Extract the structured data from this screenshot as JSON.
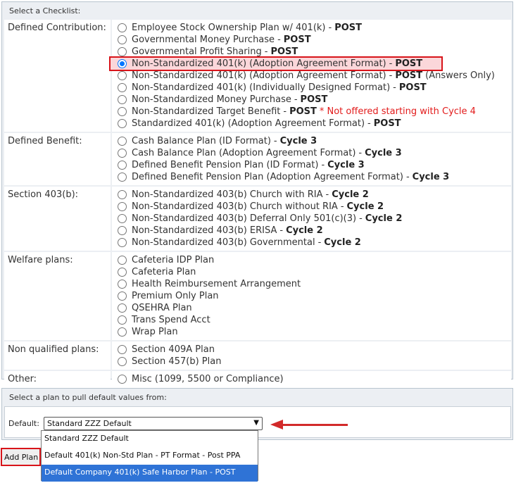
{
  "checklist": {
    "header": "Select a Checklist:",
    "sections": [
      {
        "label": "Defined Contribution:",
        "options": [
          {
            "name": "Employee Stock Ownership Plan w/ 401(k)",
            "tag": "POST",
            "suffix": "",
            "note": "",
            "checked": false
          },
          {
            "name": "Governmental Money Purchase",
            "tag": "POST",
            "suffix": "",
            "note": "",
            "checked": false
          },
          {
            "name": "Governmental Profit Sharing",
            "tag": "POST",
            "suffix": "",
            "note": "",
            "checked": false
          },
          {
            "name": "Non-Standardized 401(k) (Adoption Agreement Format)",
            "tag": "POST",
            "suffix": "",
            "note": "",
            "checked": true
          },
          {
            "name": "Non-Standardized 401(k) (Adoption Agreement Format)",
            "tag": "POST",
            "suffix": "(Answers Only)",
            "note": "",
            "checked": false
          },
          {
            "name": "Non-Standardized 401(k) (Individually Designed Format)",
            "tag": "POST",
            "suffix": "",
            "note": "",
            "checked": false
          },
          {
            "name": "Non-Standardized Money Purchase",
            "tag": "POST",
            "suffix": "",
            "note": "",
            "checked": false
          },
          {
            "name": "Non-Standardized Target Benefit",
            "tag": "POST",
            "suffix": "",
            "note": "* Not offered starting with Cycle 4",
            "checked": false
          },
          {
            "name": "Standardized 401(k) (Adoption Agreement Format)",
            "tag": "POST",
            "suffix": "",
            "note": "",
            "checked": false
          }
        ]
      },
      {
        "label": "Defined Benefit:",
        "options": [
          {
            "name": "Cash Balance Plan (ID Format)",
            "tag": "Cycle 3",
            "suffix": "",
            "note": "",
            "checked": false
          },
          {
            "name": "Cash Balance Plan (Adoption Agreement Format)",
            "tag": "Cycle 3",
            "suffix": "",
            "note": "",
            "checked": false
          },
          {
            "name": "Defined Benefit Pension Plan (ID Format)",
            "tag": "Cycle 3",
            "suffix": "",
            "note": "",
            "checked": false
          },
          {
            "name": "Defined Benefit Pension Plan (Adoption Agreement Format)",
            "tag": "Cycle 3",
            "suffix": "",
            "note": "",
            "checked": false
          }
        ]
      },
      {
        "label": "Section 403(b):",
        "options": [
          {
            "name": "Non-Standardized 403(b) Church with RIA",
            "tag": "Cycle 2",
            "suffix": "",
            "note": "",
            "checked": false
          },
          {
            "name": "Non-Standardized 403(b) Church without RIA",
            "tag": "Cycle 2",
            "suffix": "",
            "note": "",
            "checked": false
          },
          {
            "name": "Non-Standardized 403(b) Deferral Only 501(c)(3)",
            "tag": "Cycle 2",
            "suffix": "",
            "note": "",
            "checked": false
          },
          {
            "name": "Non-Standardized 403(b) ERISA",
            "tag": "Cycle 2",
            "suffix": "",
            "note": "",
            "checked": false
          },
          {
            "name": "Non-Standardized 403(b) Governmental",
            "tag": "Cycle 2",
            "suffix": "",
            "note": "",
            "checked": false
          }
        ]
      },
      {
        "label": "Welfare plans:",
        "options": [
          {
            "name": "Cafeteria IDP Plan",
            "tag": "",
            "suffix": "",
            "note": "",
            "checked": false
          },
          {
            "name": "Cafeteria Plan",
            "tag": "",
            "suffix": "",
            "note": "",
            "checked": false
          },
          {
            "name": "Health Reimbursement Arrangement",
            "tag": "",
            "suffix": "",
            "note": "",
            "checked": false
          },
          {
            "name": "Premium Only Plan",
            "tag": "",
            "suffix": "",
            "note": "",
            "checked": false
          },
          {
            "name": "QSEHRA Plan",
            "tag": "",
            "suffix": "",
            "note": "",
            "checked": false
          },
          {
            "name": "Trans Spend Acct",
            "tag": "",
            "suffix": "",
            "note": "",
            "checked": false
          },
          {
            "name": "Wrap Plan",
            "tag": "",
            "suffix": "",
            "note": "",
            "checked": false
          }
        ]
      },
      {
        "label": "Non qualified plans:",
        "options": [
          {
            "name": "Section 409A Plan",
            "tag": "",
            "suffix": "",
            "note": "",
            "checked": false
          },
          {
            "name": "Section 457(b) Plan",
            "tag": "",
            "suffix": "",
            "note": "",
            "checked": false
          }
        ]
      },
      {
        "label": "Other:",
        "options": [
          {
            "name": "Misc (1099, 5500 or Compliance)",
            "tag": "",
            "suffix": "",
            "note": "",
            "checked": false
          }
        ]
      }
    ]
  },
  "default_panel": {
    "header": "Select a plan to pull default values from:",
    "label": "Default:",
    "selected": "Standard ZZZ Default",
    "options": [
      {
        "label": "Standard ZZZ Default",
        "highlighted": false
      },
      {
        "label": "Default 401(k) Non-Std Plan - PT Format - Post PPA",
        "highlighted": false
      },
      {
        "label": "Default Company 401(k) Safe Harbor Plan - POST",
        "highlighted": true
      }
    ]
  },
  "add_plan_label": "Add Plan",
  "colors": {
    "highlight_border": "#d8141a",
    "highlight_fill": "#fbd7da",
    "note_red": "#e21b1b",
    "dropdown_active": "#2f73d6",
    "panel_bg": "#eceff3"
  }
}
